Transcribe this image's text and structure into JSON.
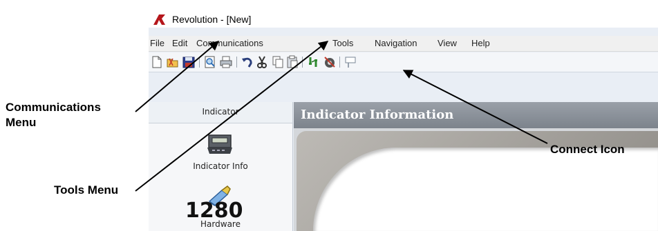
{
  "window": {
    "title": "Revolution - [New]"
  },
  "menu": {
    "file": "File",
    "edit": "Edit",
    "communications": "Communications",
    "tools": "Tools",
    "navigation": "Navigation",
    "view": "View",
    "help": "Help"
  },
  "toolbar": {
    "icons": [
      "new-file-icon",
      "open-folder-icon",
      "save-icon",
      "print-preview-icon",
      "print-icon",
      "undo-icon",
      "cut-icon",
      "copy-icon",
      "paste-icon",
      "connect-icon",
      "disconnect-icon",
      "send-icon"
    ]
  },
  "sidebar": {
    "header": "Indicator",
    "items": [
      {
        "label": "Indicator Info",
        "icon": "indicator-icon"
      },
      {
        "label": "Hardware",
        "icon": "hardware-icon"
      }
    ]
  },
  "main": {
    "title": "Indicator Information",
    "readout": "1280"
  },
  "callouts": {
    "communications_line1": "Communications",
    "communications_line2": "Menu",
    "tools": "Tools Menu",
    "connect": "Connect Icon"
  },
  "colors": {
    "logo": "#b5161b",
    "main_header": "#8a9098",
    "bezel": "#a7a39e"
  }
}
